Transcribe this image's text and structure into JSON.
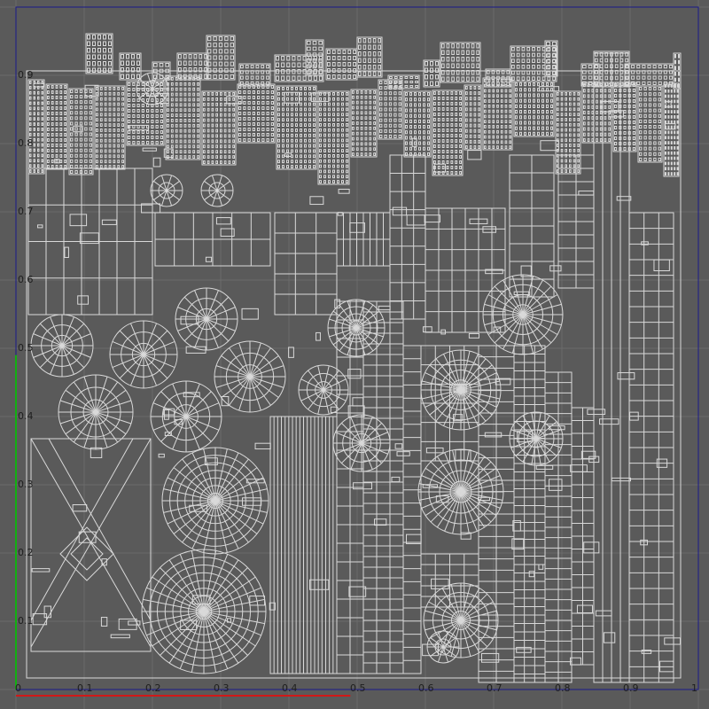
{
  "viewport": {
    "background_color": "#5a5a5a",
    "grid_color": "#6b6b6b",
    "wire_color": "#d9d9d9",
    "u_axis_color": "#d01818",
    "v_axis_color": "#12b012",
    "boundary_color": "#1a1a8a"
  },
  "u_ticks": [
    "0",
    "0.1",
    "0.2",
    "0.3",
    "0.4",
    "0.5",
    "0.6",
    "0.7",
    "0.8",
    "0.9",
    "1"
  ],
  "v_ticks": [
    "0.1",
    "0.2",
    "0.3",
    "0.4",
    "0.5",
    "0.6",
    "0.7",
    "0.8",
    "0.9"
  ]
}
